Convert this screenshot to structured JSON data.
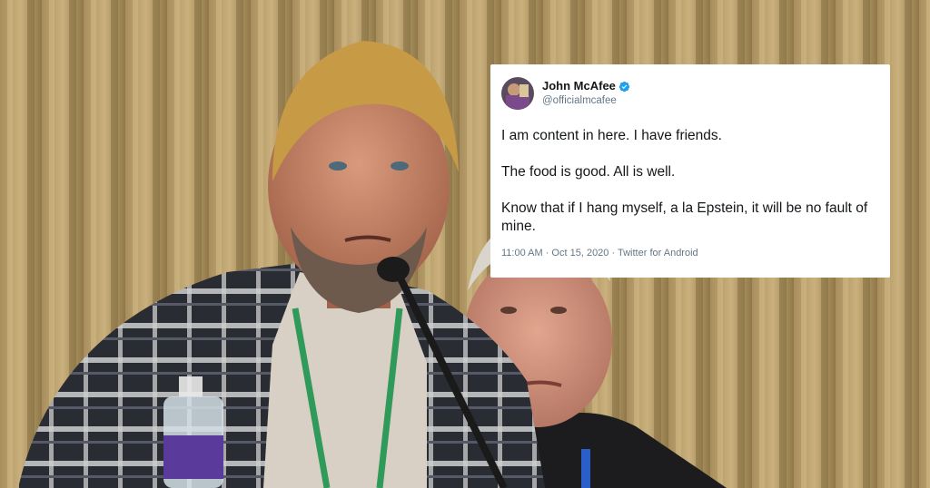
{
  "tweet": {
    "name": "John McAfee",
    "handle": "@officialmcafee",
    "verified": true,
    "lines": [
      "I am content in here. I have friends.",
      "The food is good. All is well.",
      "Know that if I hang myself, a la Epstein, it will be no fault of mine."
    ],
    "timestamp": "11:00 AM · Oct 15, 2020 · Twitter for Android"
  },
  "colors": {
    "curtain": "#b49a66",
    "tweet_bg": "#ffffff",
    "verified_blue": "#1da1f2",
    "muted_text": "#657786",
    "lanyard_green": "#2f9a5a"
  },
  "icons": {
    "verified": "verified-badge-icon",
    "avatar": "profile-avatar"
  }
}
